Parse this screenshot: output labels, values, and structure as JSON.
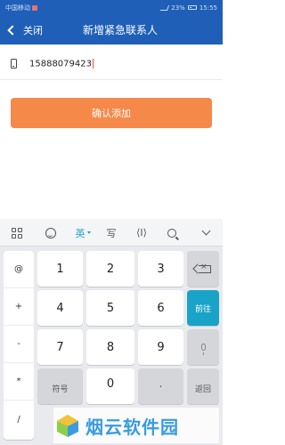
{
  "status_bar": {
    "carrier": "中国移动",
    "battery": "23%",
    "time": "15:55"
  },
  "nav": {
    "back_label": "关闭",
    "title": "新增紧急联系人"
  },
  "form": {
    "phone_value": "15888079423"
  },
  "confirm_label": "确认添加",
  "keyboard": {
    "toolbar": {
      "lang_label": "英",
      "handwrite_label": "写",
      "cursor_label": "⟨I⟩"
    },
    "side_keys": [
      "@",
      "+",
      "-",
      "*",
      "/"
    ],
    "digits": [
      "1",
      "2",
      "3",
      "4",
      "5",
      "6",
      "7",
      "8",
      "9",
      "0"
    ],
    "go_label": "前往",
    "symbol_label": "符号",
    "dot_label": ".",
    "return_label": "返回"
  },
  "watermark": {
    "text": "烟云软件园"
  }
}
